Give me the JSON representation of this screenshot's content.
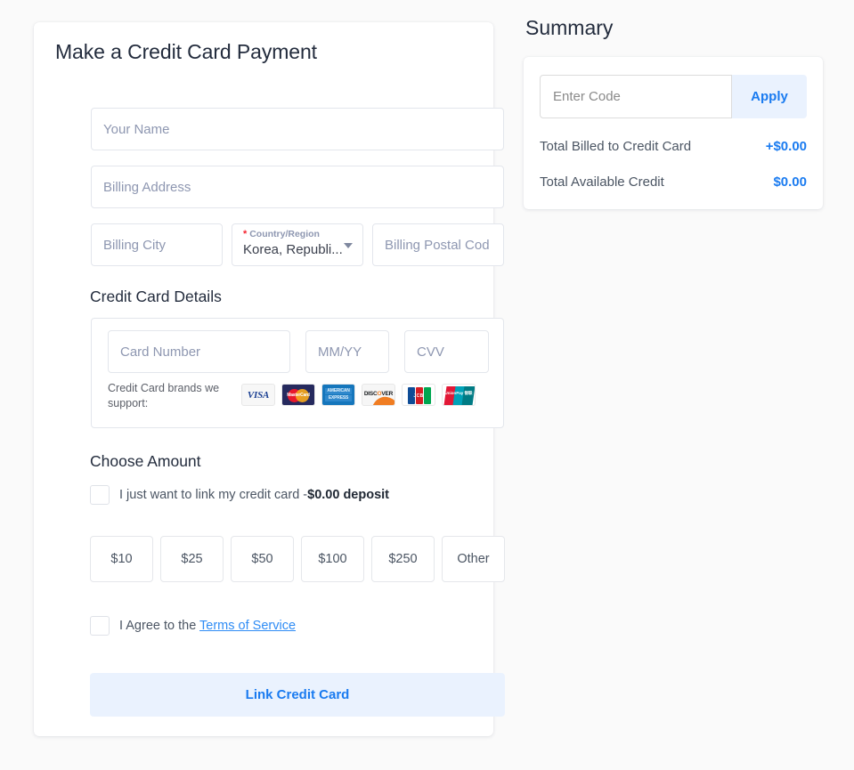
{
  "colors": {
    "accent": "#1a7bf0",
    "accent_soft_bg": "#eaf2fe",
    "page_bg": "#fafafa",
    "card_bg": "#ffffff",
    "border": "#e3e6ec",
    "placeholder": "#8e97b1",
    "heading": "#232c3d",
    "required_asterisk": "#f5222d"
  },
  "form": {
    "title": "Make a Credit Card Payment",
    "fields": {
      "name_placeholder": "Your Name",
      "address_placeholder": "Billing Address",
      "city_placeholder": "Billing City",
      "postal_placeholder": "Billing Postal Cod"
    },
    "country": {
      "label": "Country/Region",
      "required_mark": "*",
      "value": "Korea, Republi...",
      "caret_icon": "chevron-down-icon"
    },
    "credit_card": {
      "section_title": "Credit Card Details",
      "card_number_placeholder": "Card Number",
      "expiry_placeholder": "MM/YY",
      "cvv_placeholder": "CVV",
      "brands_label": "Credit Card brands we support:",
      "brands": [
        {
          "name": "visa",
          "text": "VISA"
        },
        {
          "name": "mastercard",
          "text": "MasterCard"
        },
        {
          "name": "amex",
          "line1": "AMERICAN",
          "line2": "EXPRESS"
        },
        {
          "name": "discover",
          "text_a": "DISC",
          "text_o": "O",
          "text_b": "VER"
        },
        {
          "name": "jcb",
          "text": "JCB"
        },
        {
          "name": "unionpay",
          "line1": "UnionPay",
          "line2": "银联"
        }
      ]
    },
    "amount": {
      "section_title": "Choose Amount",
      "link_only_label_prefix": "I just want to link my credit card -",
      "link_only_label_bold": "$0.00 deposit",
      "options": [
        "$10",
        "$25",
        "$50",
        "$100",
        "$250",
        "Other"
      ]
    },
    "terms": {
      "prefix": "I Agree to the ",
      "link": "Terms of Service"
    },
    "submit_label": "Link Credit Card"
  },
  "summary": {
    "title": "Summary",
    "code_placeholder": "Enter Code",
    "apply_label": "Apply",
    "lines": [
      {
        "label": "Total Billed to Credit Card",
        "value": "+$0.00"
      },
      {
        "label": "Total Available Credit",
        "value": "$0.00"
      }
    ]
  }
}
